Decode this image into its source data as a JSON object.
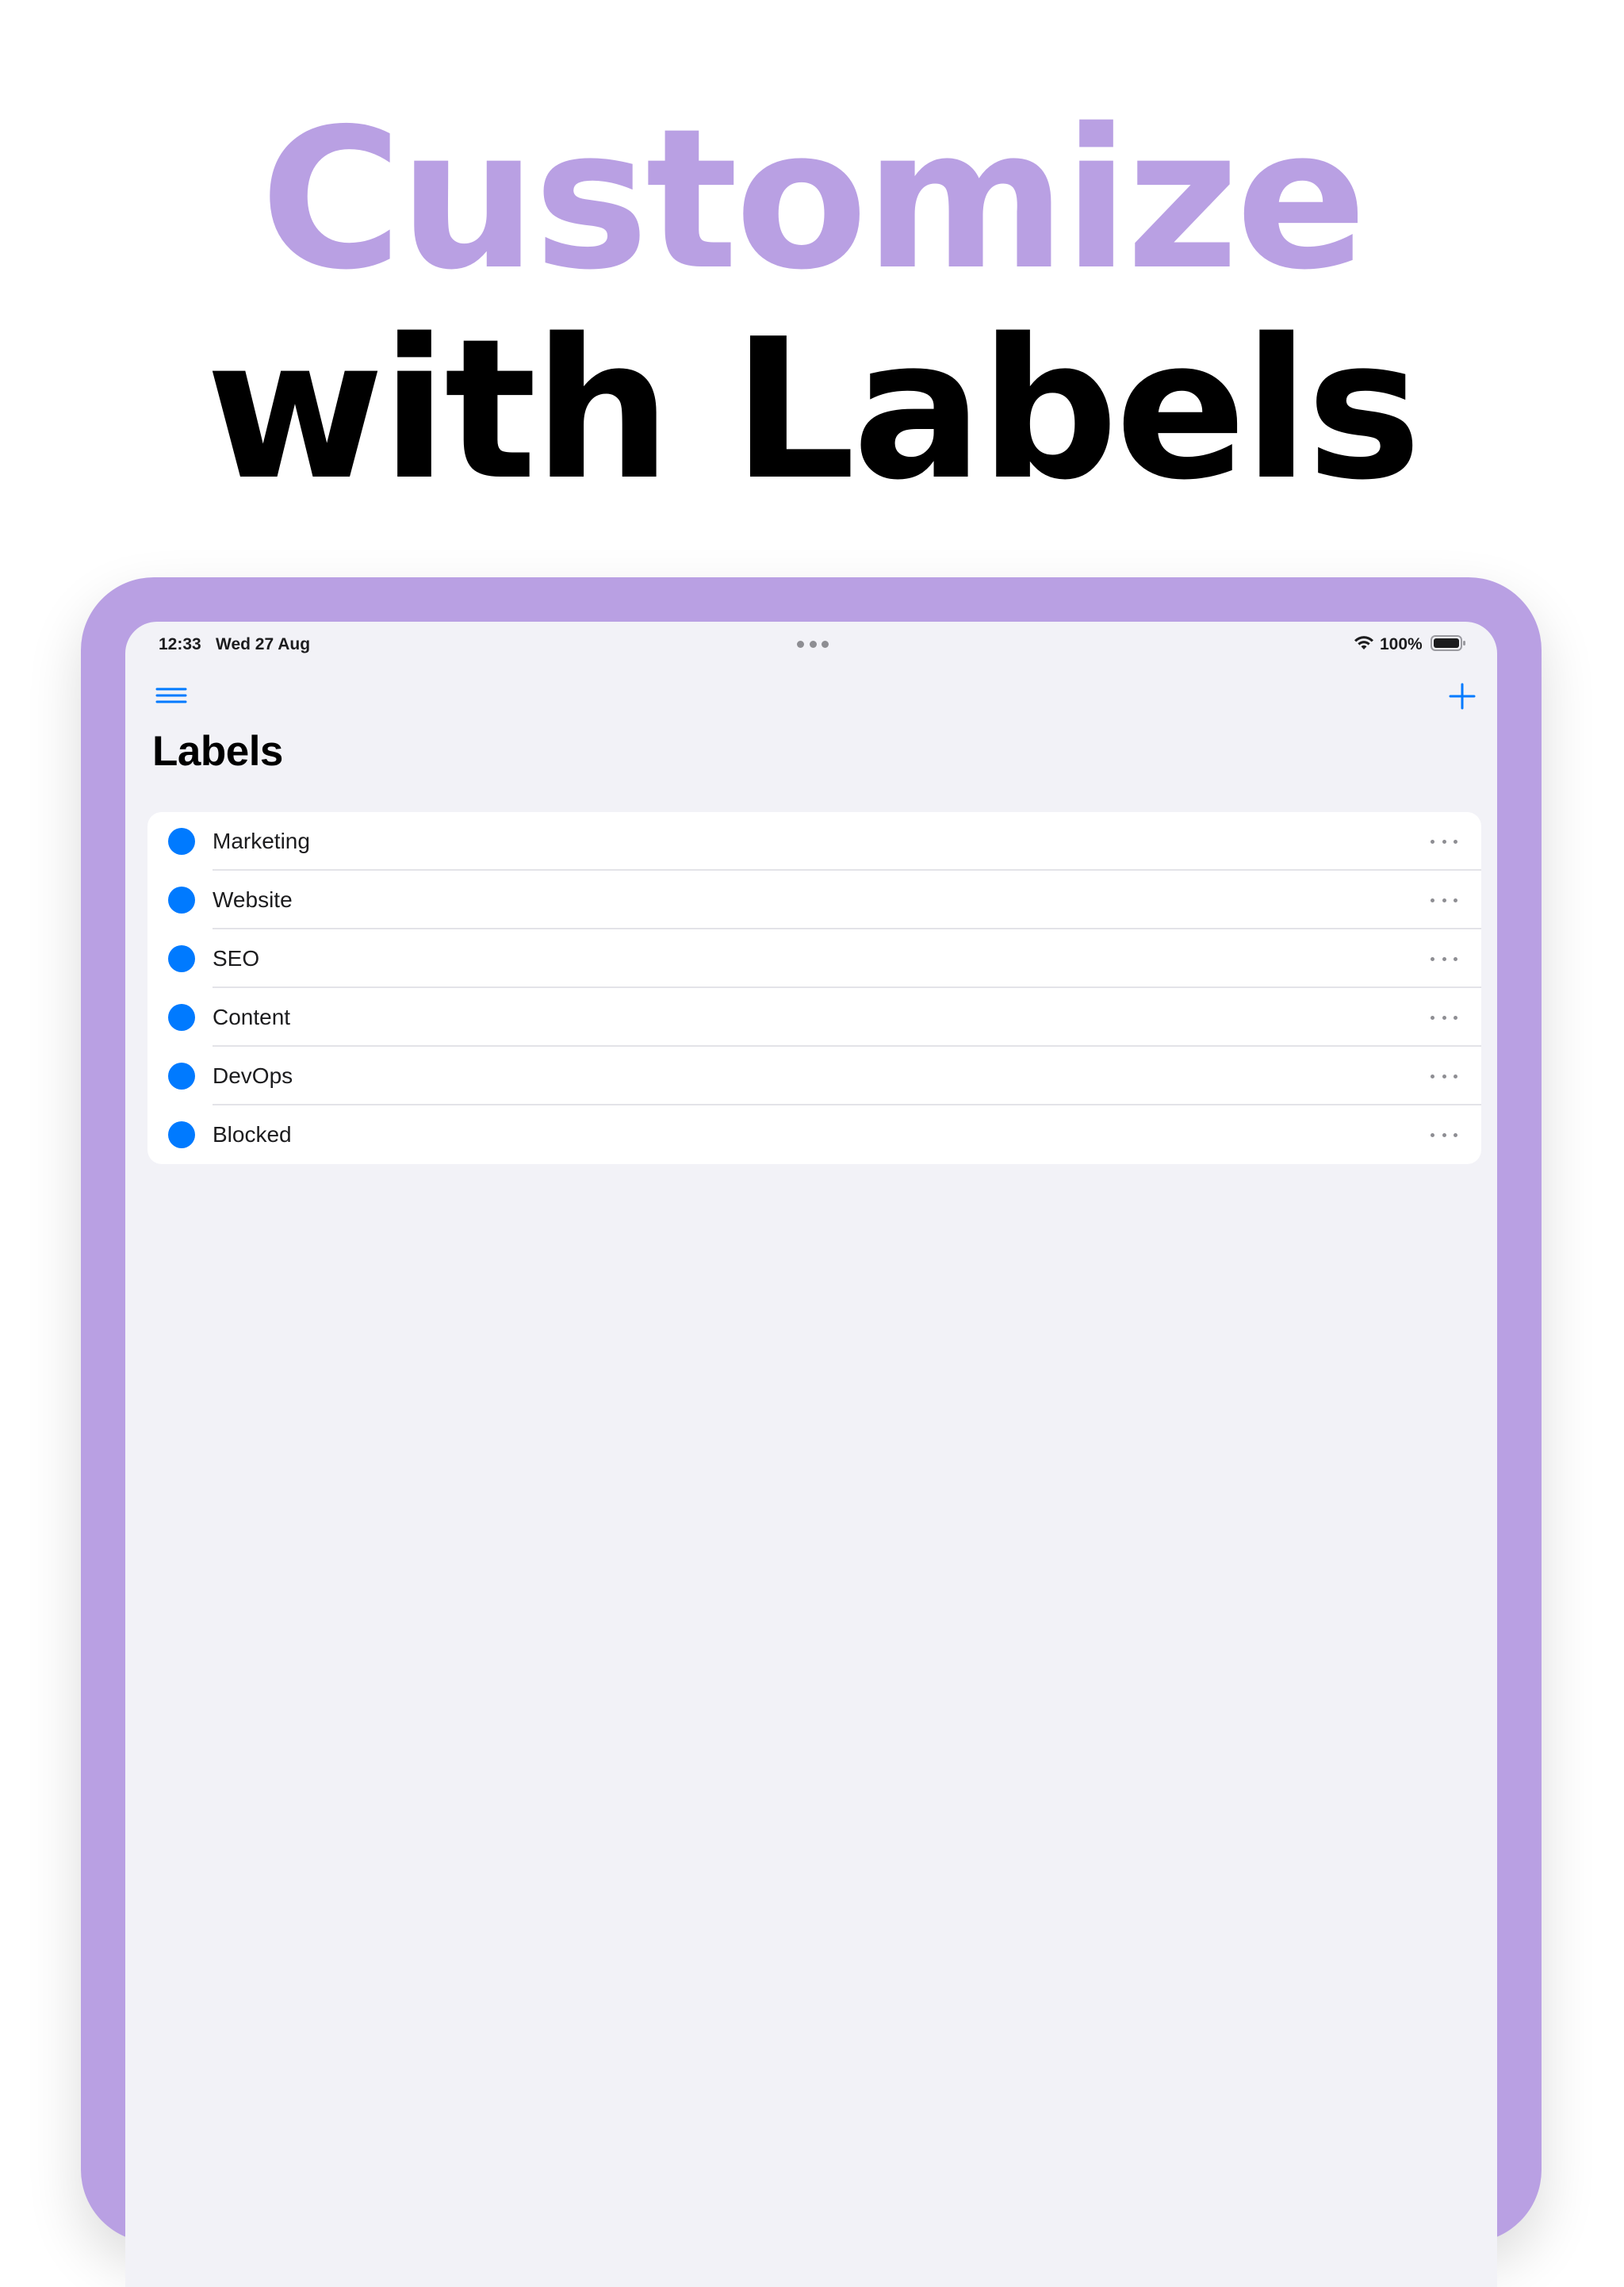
{
  "headline": {
    "line1": "Customize",
    "line2": "with Labels"
  },
  "colors": {
    "accent": "#b9a0e3",
    "ios_blue": "#007aff",
    "screen_bg": "#f2f2f7"
  },
  "status_bar": {
    "time": "12:33",
    "date": "Wed 27 Aug",
    "battery_percent": "100%",
    "icons": [
      "wifi-icon",
      "battery-icon",
      "multitask-dots-icon"
    ]
  },
  "nav": {
    "menu_icon": "hamburger-menu-icon",
    "add_icon": "plus-icon",
    "title": "Labels"
  },
  "labels": [
    {
      "name": "Marketing",
      "color": "#007aff"
    },
    {
      "name": "Website",
      "color": "#007aff"
    },
    {
      "name": "SEO",
      "color": "#007aff"
    },
    {
      "name": "Content",
      "color": "#007aff"
    },
    {
      "name": "DevOps",
      "color": "#007aff"
    },
    {
      "name": "Blocked",
      "color": "#007aff"
    }
  ]
}
